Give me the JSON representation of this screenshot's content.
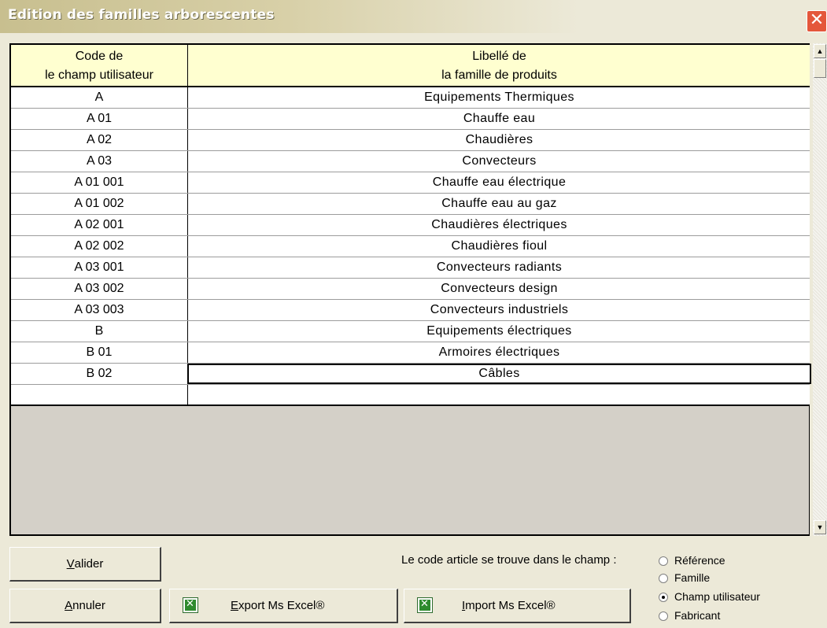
{
  "window": {
    "title": "Edition des familles arborescentes",
    "close_glyph": "✕"
  },
  "grid": {
    "columns": [
      {
        "line1": "Code de",
        "line2": "le champ utilisateur"
      },
      {
        "line1": "Libellé de",
        "line2": "la famille de produits"
      }
    ],
    "rows": [
      [
        "A",
        "Equipements Thermiques"
      ],
      [
        "A 01",
        "Chauffe eau"
      ],
      [
        "A 02",
        "Chaudières"
      ],
      [
        "A 03",
        "Convecteurs"
      ],
      [
        "A 01 001",
        "Chauffe eau électrique"
      ],
      [
        "A 01 002",
        "Chauffe eau au gaz"
      ],
      [
        "A 02 001",
        "Chaudières électriques"
      ],
      [
        "A 02 002",
        "Chaudières fioul"
      ],
      [
        "A 03 001",
        "Convecteurs radiants"
      ],
      [
        "A 03 002",
        "Convecteurs design"
      ],
      [
        "A 03 003",
        "Convecteurs industriels"
      ],
      [
        "B",
        "Equipements électriques"
      ],
      [
        "B 01",
        "Armoires électriques"
      ],
      [
        "B 02",
        "Câbles"
      ],
      [
        "",
        ""
      ]
    ],
    "selected_row": 13
  },
  "scrollbar": {
    "up": "▲",
    "down": "▼"
  },
  "buttons": {
    "valider": {
      "mnemonic": "V",
      "rest": "alider"
    },
    "annuler": {
      "mnemonic": "A",
      "rest": "nnuler"
    },
    "export": {
      "mnemonic": "E",
      "rest": "xport Ms Excel®",
      "icon": "excel-icon"
    },
    "import": {
      "mnemonic": "I",
      "rest": "mport Ms Excel®",
      "icon": "excel-icon"
    }
  },
  "code_location": {
    "label": "Le code article se trouve dans le champ :",
    "options": [
      "Référence",
      "Famille",
      "Champ utilisateur",
      "Fabricant"
    ],
    "selected": "Champ utilisateur"
  }
}
